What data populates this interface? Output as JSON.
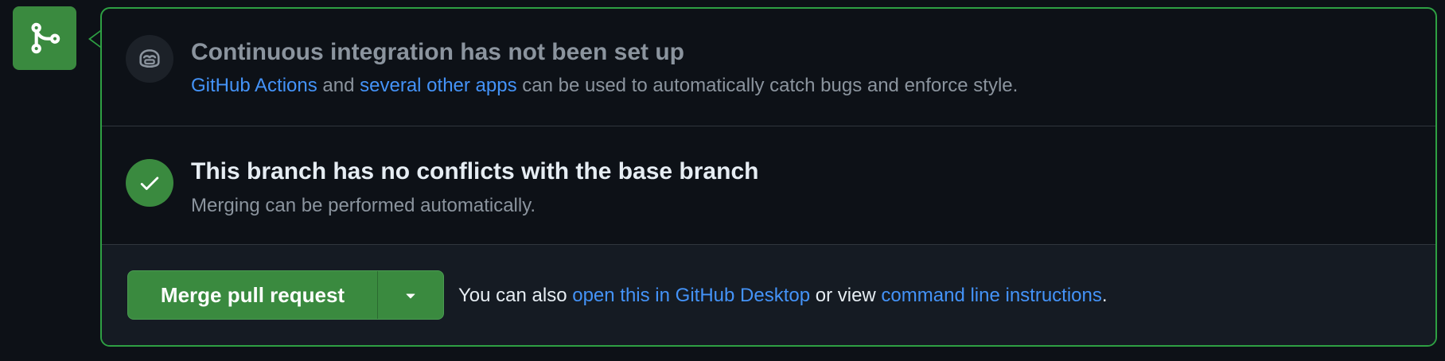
{
  "ci": {
    "title": "Continuous integration has not been set up",
    "link_actions": "GitHub Actions",
    "text_and": " and ",
    "link_other_apps": "several other apps",
    "text_rest": " can be used to automatically catch bugs and enforce style."
  },
  "conflicts": {
    "title": "This branch has no conflicts with the base branch",
    "subtitle": "Merging can be performed automatically."
  },
  "merge": {
    "button_label": "Merge pull request",
    "note_prefix": "You can also ",
    "link_desktop": "open this in GitHub Desktop",
    "note_middle": " or view ",
    "link_cli": "command line instructions",
    "note_suffix": "."
  },
  "icons": {
    "badge": "git-merge-icon",
    "ci": "copilot-icon",
    "conflicts": "check-icon",
    "dropdown": "triangle-down-icon"
  },
  "colors": {
    "success": "#3a8a3f",
    "border_success": "#2ea043",
    "link": "#4493f8",
    "background": "#0d1117"
  }
}
